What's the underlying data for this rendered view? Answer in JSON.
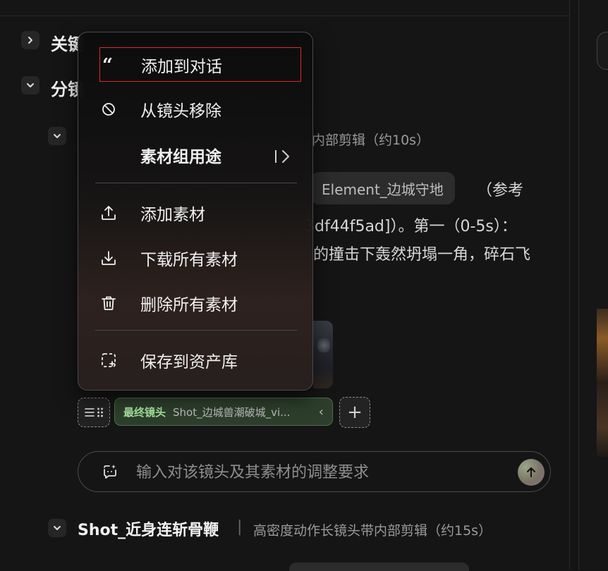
{
  "sections": {
    "keyframes_title_partial": "关键",
    "storyboard_title_partial": "分镜"
  },
  "shot1": {
    "meta_partial": "内部剪辑（约10s）",
    "element_chip": "Element_边城守地",
    "ref_partial": "（参考",
    "line2_partial": "3df44f5ad]）。第一（0-5s）：",
    "line3_partial": "的撞击下轰然坍塌一角，碎石飞",
    "final_shot_label": "最终镜头",
    "final_shot_name": "Shot_边城兽潮破城_vi...",
    "add_label": "+"
  },
  "input": {
    "placeholder": "输入对该镜头及其素材的调整要求"
  },
  "shot2": {
    "title": "Shot_近身连斩骨鞭",
    "divider": "|",
    "meta": "高密度动作长镜头带内部剪辑（约15s）"
  },
  "context_menu": {
    "items": [
      {
        "label": "添加到对话",
        "icon": "quote-icon"
      },
      {
        "label": "从镜头移除",
        "icon": "remove-circle-icon"
      },
      {
        "label": "素材组用途",
        "icon": "",
        "submenu": true
      },
      {
        "label": "添加素材",
        "icon": "upload-icon"
      },
      {
        "label": "下载所有素材",
        "icon": "download-icon"
      },
      {
        "label": "删除所有素材",
        "icon": "trash-icon"
      },
      {
        "label": "保存到资产库",
        "icon": "dashed-add-box-icon"
      }
    ]
  },
  "colors": {
    "highlight_border": "#d92a2a",
    "final_tag_bg": "#2d3f2c",
    "final_tag_text": "#a8e0a0"
  }
}
